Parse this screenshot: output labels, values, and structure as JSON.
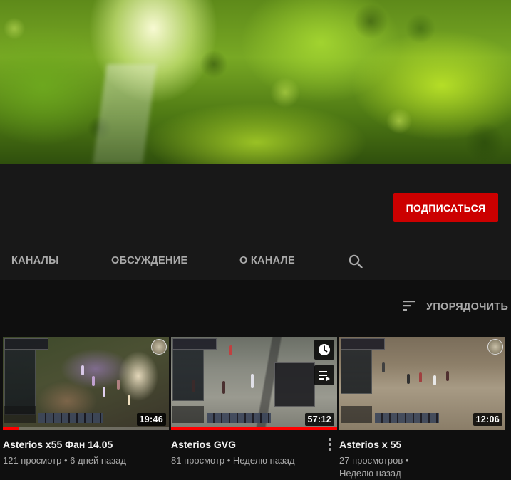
{
  "channel": {
    "subscribe_label": "ПОДПИСАТЬСЯ"
  },
  "tabs": [
    {
      "label": "КАНАЛЫ"
    },
    {
      "label": "ОБСУЖДЕНИЕ"
    },
    {
      "label": "О КАНАЛЕ"
    }
  ],
  "icons": {
    "search": "search-icon",
    "sort": "sort-icon",
    "watch_later": "clock-icon",
    "add_to_queue": "playlist-add-icon",
    "more": "more-vert-icon"
  },
  "sort": {
    "label": "УПОРЯДОЧИТЬ"
  },
  "colors": {
    "accent": "#cc0000",
    "progress": "#ff0000",
    "background": "#0f0f0f",
    "header": "#181818"
  },
  "videos": [
    {
      "title": "Asterios x55 Фан 14.05",
      "duration": "19:46",
      "views": "121 просмотр",
      "age": "6 дней назад",
      "watched_fraction": 0.1
    },
    {
      "title": "Asterios GVG",
      "duration": "57:12",
      "views": "81 просмотр",
      "age": "Неделю назад",
      "watched_fraction": 1.0
    },
    {
      "title": "Asterios x 55",
      "duration": "12:06",
      "views": "27 просмотров",
      "age": "Неделю назад",
      "watched_fraction": 0
    }
  ]
}
